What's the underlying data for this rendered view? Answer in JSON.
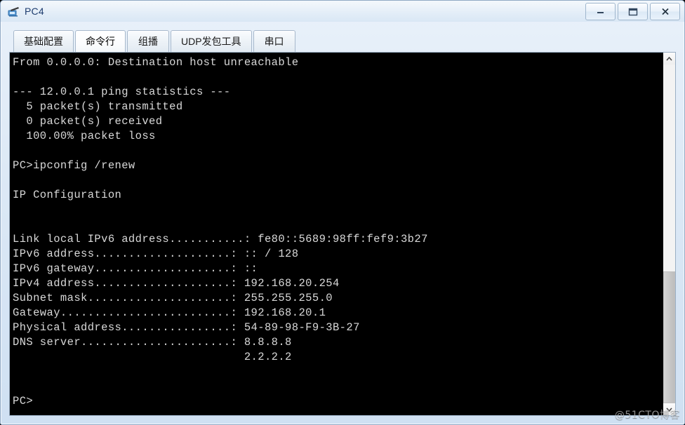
{
  "window": {
    "title": "PC4",
    "icon": "pc-device-icon",
    "controls": [
      {
        "name": "minimize-button",
        "glyph": "minimize-icon",
        "label": "–"
      },
      {
        "name": "maximize-button",
        "glyph": "maximize-icon",
        "label": "❐"
      },
      {
        "name": "close-button",
        "glyph": "close-icon",
        "label": "X"
      }
    ]
  },
  "tabs": [
    {
      "label": "基础配置",
      "active": false
    },
    {
      "label": "命令行",
      "active": true
    },
    {
      "label": "组播",
      "active": false
    },
    {
      "label": "UDP发包工具",
      "active": false
    },
    {
      "label": "串口",
      "active": false
    }
  ],
  "terminal": {
    "text": "From 0.0.0.0: Destination host unreachable\n\n--- 12.0.0.1 ping statistics ---\n  5 packet(s) transmitted\n  0 packet(s) received\n  100.00% packet loss\n\nPC>ipconfig /renew\n\nIP Configuration\n\n\nLink local IPv6 address...........: fe80::5689:98ff:fef9:3b27\nIPv6 address....................: :: / 128\nIPv6 gateway....................: ::\nIPv4 address....................: 192.168.20.254\nSubnet mask.....................: 255.255.255.0\nGateway.........................: 192.168.20.1\nPhysical address................: 54-89-98-F9-3B-27\nDNS server......................: 8.8.8.8\n                                  2.2.2.2\n\n\nPC>",
    "lines": [
      "From 0.0.0.0: Destination host unreachable",
      "",
      "--- 12.0.0.1 ping statistics ---",
      "  5 packet(s) transmitted",
      "  0 packet(s) received",
      "  100.00% packet loss",
      "",
      "PC>ipconfig /renew",
      "",
      "IP Configuration",
      "",
      "",
      "Link local IPv6 address...........: fe80::5689:98ff:fef9:3b27",
      "IPv6 address....................: :: / 128",
      "IPv6 gateway....................: ::",
      "IPv4 address....................: 192.168.20.254",
      "Subnet mask.....................: 255.255.255.0",
      "Gateway.........................: 192.168.20.1",
      "Physical address................: 54-89-98-F9-3B-27",
      "DNS server......................: 8.8.8.8",
      "                                  2.2.2.2",
      "",
      "",
      "PC>"
    ],
    "ping_summary": {
      "target": "12.0.0.1",
      "transmitted": "5",
      "received": "0",
      "packet_loss": "100.00%",
      "error": "From 0.0.0.0: Destination host unreachable"
    },
    "command": "ipconfig /renew",
    "prompt": "PC>",
    "ip_configuration": {
      "heading": "IP Configuration",
      "entries": [
        {
          "key": "Link local IPv6 address",
          "value": "fe80::5689:98ff:fef9:3b27"
        },
        {
          "key": "IPv6 address",
          "value": ":: / 128"
        },
        {
          "key": "IPv6 gateway",
          "value": "::"
        },
        {
          "key": "IPv4 address",
          "value": "192.168.20.254"
        },
        {
          "key": "Subnet mask",
          "value": "255.255.255.0"
        },
        {
          "key": "Gateway",
          "value": "192.168.20.1"
        },
        {
          "key": "Physical address",
          "value": "54-89-98-F9-3B-27"
        },
        {
          "key": "DNS server",
          "value": "8.8.8.8"
        },
        {
          "key": "",
          "value": "2.2.2.2"
        }
      ]
    }
  },
  "scrollbar": {
    "up_arrow": "▲",
    "down_arrow": "▼",
    "thumb_top_percent": "61%"
  },
  "watermark": {
    "text": "@51CTO博客"
  },
  "colors": {
    "terminal_bg": "#000000",
    "terminal_fg": "#d8d8d8",
    "window_chrome": "#dde9f6",
    "title_text": "#1d3c6e",
    "tab_border": "#a7b8cb"
  }
}
